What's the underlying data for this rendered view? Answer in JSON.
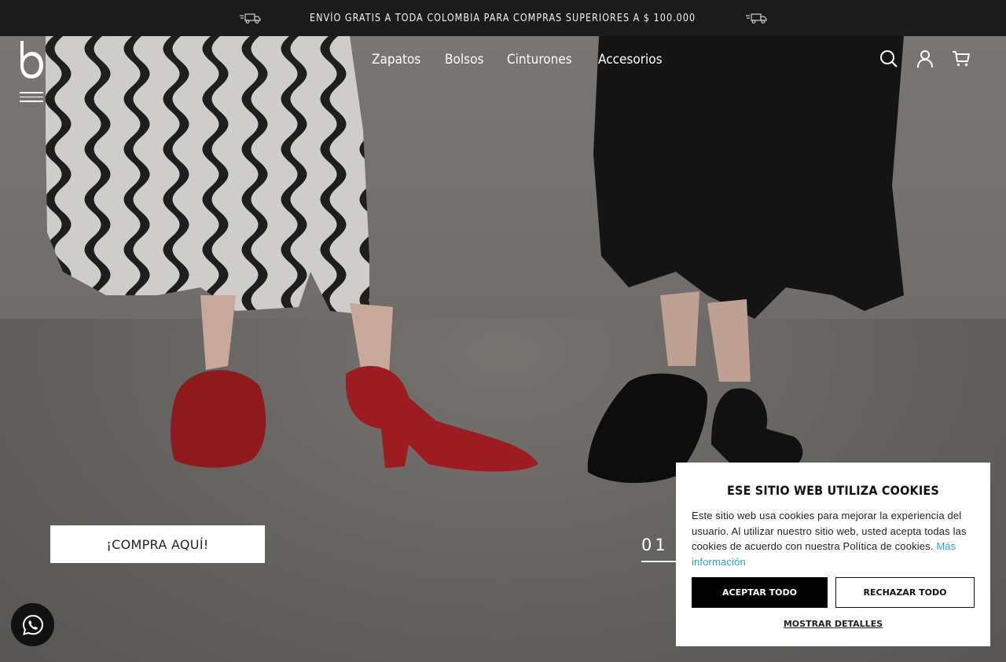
{
  "announcement": {
    "text": "ENVÍO GRATIS A TODA COLOMBIA PARA COMPRAS SUPERIORES A $ 100.000"
  },
  "header": {
    "nav": [
      {
        "label": "Zapatos"
      },
      {
        "label": "Bolsos"
      },
      {
        "label": "Cinturones"
      },
      {
        "label": "Accesorios"
      }
    ],
    "icons": [
      "search-icon",
      "account-icon",
      "cart-icon"
    ]
  },
  "hero": {
    "cta_label": "¡COMPRA AQUÍ!",
    "slide_index": "01"
  },
  "cookie_banner": {
    "title": "ESE SITIO WEB UTILIZA COOKIES",
    "body": "Este sitio web usa cookies para mejorar la experiencia del usuario. Al utilizar nuestro sitio web, usted acepta todas las cookies de acuerdo con nuestra Política de cookies.",
    "more_link": "Más información",
    "accept_label": "ACEPTAR TODO",
    "reject_label": "RECHAZAR TODO",
    "details_label": "MOSTRAR DETALLES"
  },
  "colors": {
    "topbar": "#1b1b1b",
    "link": "#2aa0d6",
    "accept_bg": "#000000"
  }
}
